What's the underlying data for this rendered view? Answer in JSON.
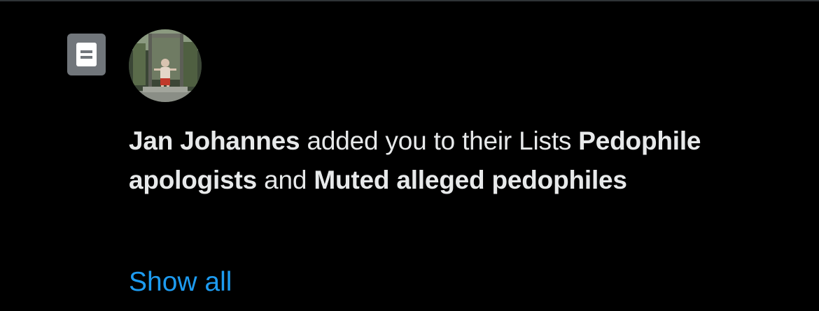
{
  "notification": {
    "actor_name": "Jan Johannes",
    "action_text": " added you to their Lists ",
    "list_one": "Pedophile apologists",
    "conjunction": " and ",
    "list_two": "Muted alleged pedophiles",
    "show_all_label": "Show all",
    "type_icon": "list-icon",
    "avatar_alt": "Jan Johannes"
  },
  "colors": {
    "background": "#000000",
    "text": "#e7e9ea",
    "link": "#1d9bf0",
    "icon_badge": "#71767b",
    "divider": "#2f3336"
  }
}
